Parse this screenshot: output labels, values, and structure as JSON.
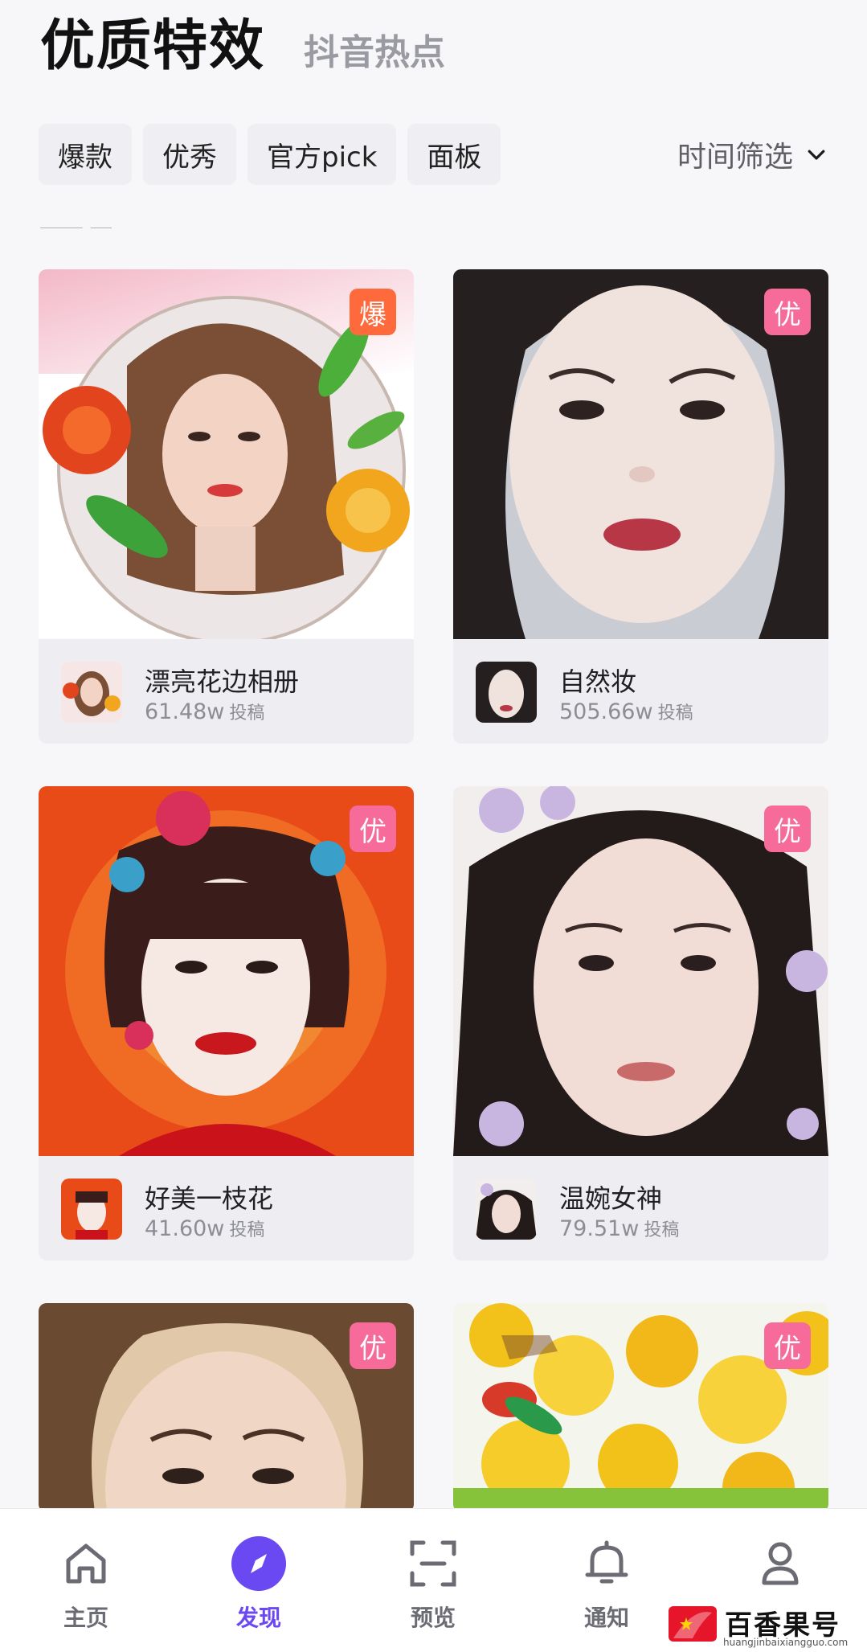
{
  "header": {
    "active_tab": "优质特效",
    "other_tab": "抖音热点"
  },
  "filters": {
    "chips": [
      "爆款",
      "优秀",
      "官方pick",
      "面板"
    ],
    "time_filter": "时间筛选"
  },
  "colors": {
    "accent": "#6a48f2",
    "badge_hot": "#ff6a3c",
    "badge_good": "#f76b9a"
  },
  "cards": [
    {
      "title": "漂亮花边相册",
      "count": "61.48w",
      "unit": "投稿",
      "badge": "爆",
      "badge_type": "hot"
    },
    {
      "title": "自然妆",
      "count": "505.66w",
      "unit": "投稿",
      "badge": "优",
      "badge_type": "good"
    },
    {
      "title": "好美一枝花",
      "count": "41.60w",
      "unit": "投稿",
      "badge": "优",
      "badge_type": "good"
    },
    {
      "title": "温婉女神",
      "count": "79.51w",
      "unit": "投稿",
      "badge": "优",
      "badge_type": "good"
    },
    {
      "title": "",
      "count": "",
      "unit": "",
      "badge": "优",
      "badge_type": "good"
    },
    {
      "title": "",
      "count": "",
      "unit": "",
      "badge": "优",
      "badge_type": "good"
    }
  ],
  "nav": [
    {
      "label": "主页",
      "icon": "home-icon"
    },
    {
      "label": "发现",
      "icon": "compass-icon",
      "active": true
    },
    {
      "label": "预览",
      "icon": "scan-icon"
    },
    {
      "label": "通知",
      "icon": "bell-icon"
    },
    {
      "label": "",
      "icon": "profile-icon"
    }
  ],
  "watermark": {
    "name": "百香果号",
    "url": "huangjinbaixiangguo.com"
  }
}
